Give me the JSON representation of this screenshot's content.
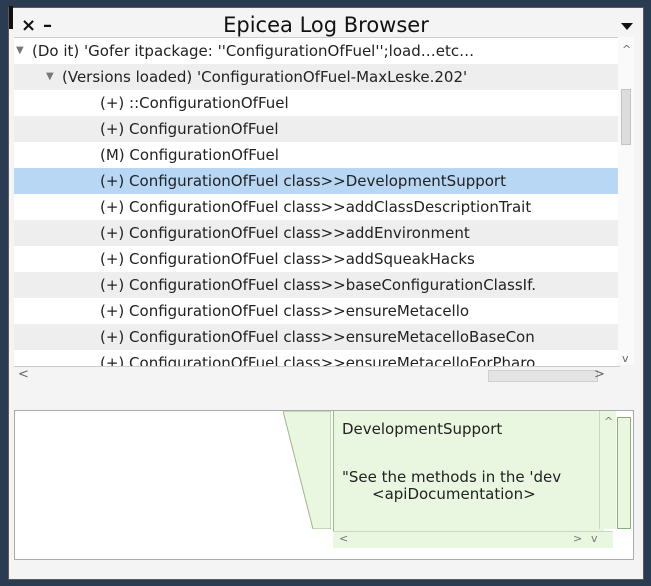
{
  "window": {
    "title": "Epicea Log Browser"
  },
  "tree": {
    "rows": [
      {
        "text": "(Do it) 'Gofer itpackage: ''ConfigurationOfFuel'';load…etc…",
        "expanded": true
      },
      {
        "text": "(Versions loaded) 'ConfigurationOfFuel-MaxLeske.202'",
        "expanded": true
      },
      {
        "text": "(+) ::ConfigurationOfFuel"
      },
      {
        "text": "(+) ConfigurationOfFuel"
      },
      {
        "text": "(M) ConfigurationOfFuel"
      },
      {
        "text": "(+) ConfigurationOfFuel class>>DevelopmentSupport",
        "selected": true
      },
      {
        "text": "(+) ConfigurationOfFuel class>>addClassDescriptionTrait"
      },
      {
        "text": "(+) ConfigurationOfFuel class>>addEnvironment"
      },
      {
        "text": "(+) ConfigurationOfFuel class>>addSqueakHacks"
      },
      {
        "text": "(+) ConfigurationOfFuel class>>baseConfigurationClassIf."
      },
      {
        "text": "(+) ConfigurationOfFuel class>>ensureMetacello"
      },
      {
        "text": "(+) ConfigurationOfFuel class>>ensureMetacelloBaseCon"
      },
      {
        "text": "(+) ConfigurationOfFuel class>>ensureMetacelloForPharo"
      }
    ]
  },
  "doc": {
    "line1": "DevelopmentSupport",
    "line2": "\"See the methods in the 'dev",
    "line3": "<apiDocumentation>"
  },
  "icons": {
    "close": "×",
    "minimize": "–",
    "expanded_arrow": "▼",
    "caret_up": "^",
    "caret_down": "v",
    "caret_left": "<",
    "caret_right": ">"
  }
}
